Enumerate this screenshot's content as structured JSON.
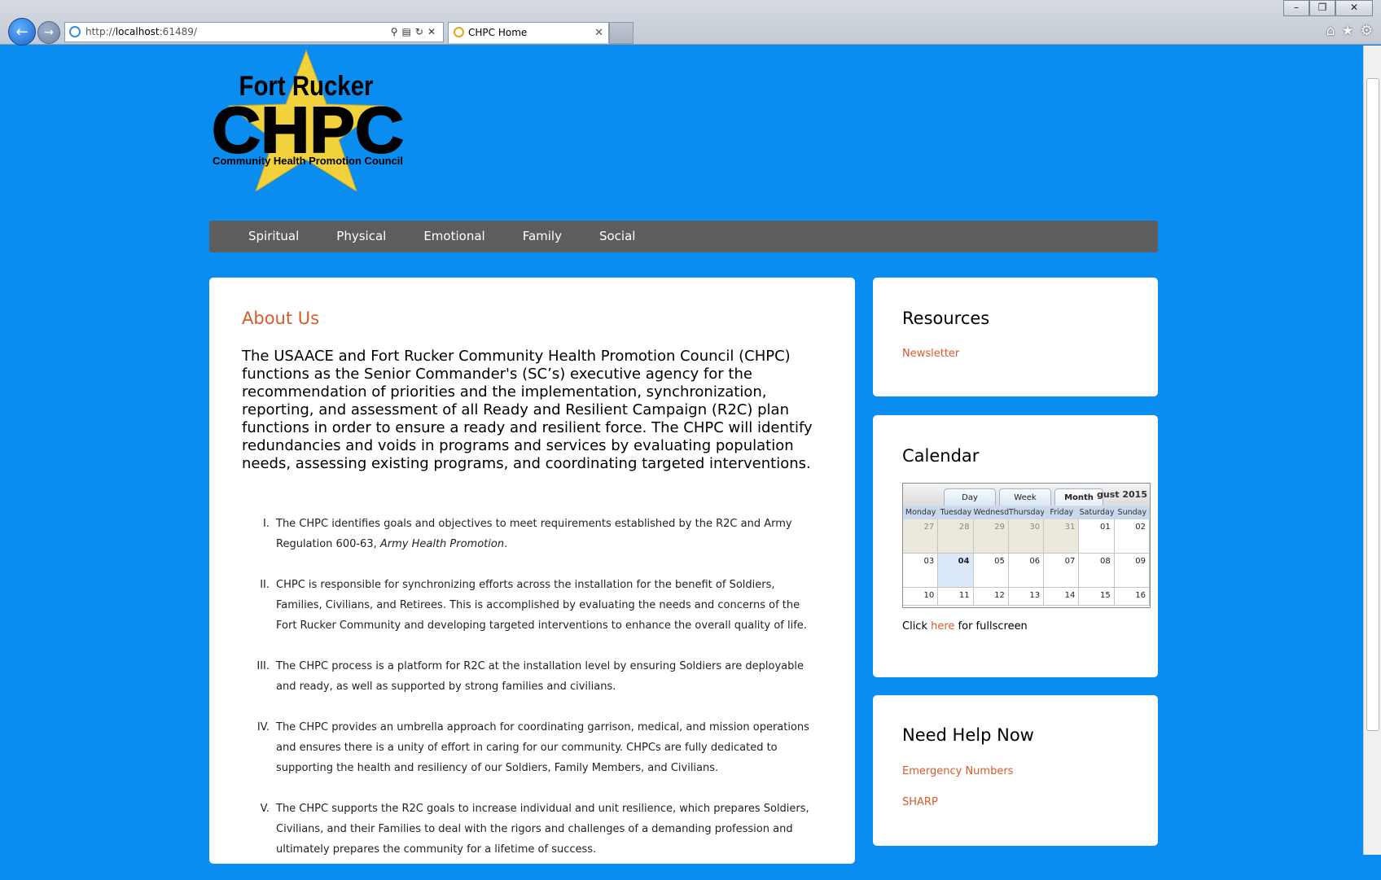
{
  "browser": {
    "address": {
      "prefix": "http://",
      "host": "localhost",
      "port": ":61489/"
    },
    "tab_title": "CHPC Home",
    "window_controls": [
      "minimize",
      "maximize",
      "close"
    ],
    "toolbar_icons": [
      "home-icon",
      "star-icon",
      "gear-icon"
    ]
  },
  "logo": {
    "line1": "Fort Rucker",
    "line2": "CHPC",
    "line3": "Community Health Promotion Council"
  },
  "menu": [
    "Spiritual",
    "Physical",
    "Emotional",
    "Family",
    "Social"
  ],
  "about": {
    "title": "About Us",
    "intro": "The USAACE and Fort Rucker Community Health Promotion Council (CHPC) functions as the Senior Commander's (SC’s) executive agency for the recommendation of priorities and the implementation, synchronization, reporting, and assessment of all Ready and Resilient Campaign (R2C) plan functions in order to ensure a ready and resilient force. The CHPC will identify redundancies and voids in programs and services by evaluating population needs, assessing existing programs, and coordinating targeted interventions.",
    "items": [
      {
        "num": "I.",
        "text": "The CHPC identifies goals and objectives to meet requirements established by the R2C and Army Regulation 600-63, ",
        "emph": "Army Health Promotion",
        "tail": "."
      },
      {
        "num": "II.",
        "text": "CHPC is responsible for synchronizing efforts across the installation for the benefit of Soldiers, Families, Civilians, and Retirees. This is accomplished by evaluating the needs and concerns of the Fort Rucker Community and developing targeted interventions to enhance the overall quality of life."
      },
      {
        "num": "III.",
        "text": "The CHPC process is a platform for R2C at the installation level by ensuring Soldiers are deployable and ready, as well as supported by strong families and civilians."
      },
      {
        "num": "IV.",
        "text": "The CHPC provides an umbrella approach for coordinating garrison, medical, and mission operations and ensures there is a unity of effort in caring for our community. CHPCs are fully dedicated to supporting the health and resiliency of our Soldiers, Family Members, and Civilians."
      },
      {
        "num": "V.",
        "text": "The CHPC supports the R2C goals to increase individual and unit resilience, which prepares Soldiers, Civilians, and their Families to deal with the rigors and challenges of a demanding profession and ultimately prepares the community for a lifetime of success."
      }
    ]
  },
  "resources": {
    "title": "Resources",
    "newsletter": "Newsletter"
  },
  "calendar": {
    "title": "Calendar",
    "views": [
      "Day",
      "Week",
      "Month"
    ],
    "month_label": "gust 2015",
    "weekdays": [
      "Monday",
      "Tuesday",
      "Wednesday",
      "Thursday",
      "Friday",
      "Saturday",
      "Sunday"
    ],
    "weeks": [
      [
        "27",
        "28",
        "29",
        "30",
        "31",
        "01",
        "02"
      ],
      [
        "03",
        "04",
        "05",
        "06",
        "07",
        "08",
        "09"
      ],
      [
        "10",
        "11",
        "12",
        "13",
        "14",
        "15",
        "16"
      ]
    ],
    "note_before": "Click ",
    "note_link": "here",
    "note_after": " for fullscreen"
  },
  "help": {
    "title": "Need Help Now",
    "emergency": "Emergency Numbers",
    "sharp": "SHARP"
  },
  "colors": {
    "page_bg": "#0a8df0",
    "accent": "#d75b2b",
    "menu_bg": "#5d5d5d",
    "logo_star": "#f1d23c"
  }
}
